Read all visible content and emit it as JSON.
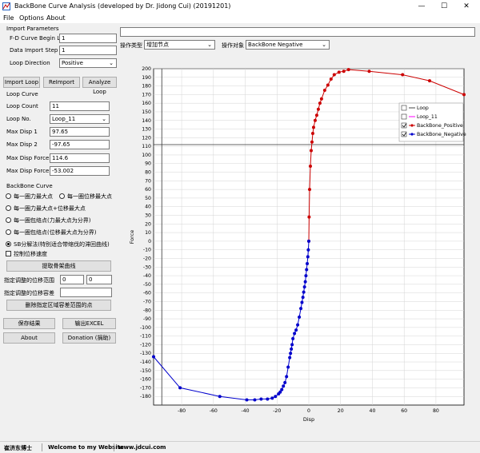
{
  "window": {
    "title": "BackBone Curve Analysis (developed by Dr. Jidong Cui) (20191201)",
    "minimize": "—",
    "maximize": "☐",
    "close": "✕"
  },
  "menu": [
    "File",
    "Options",
    "About"
  ],
  "import": {
    "group_label": "Import Parameters",
    "curve_begin_label": "F-D Curve Begin Line",
    "curve_begin_value": "1",
    "data_step_label": "Data Import Step",
    "data_step_value": "1",
    "loop_dir_label": "Loop Direction",
    "loop_dir_value": "Positive"
  },
  "buttons": {
    "import_loop": "Import Loop",
    "reimport": "ReImport",
    "analyze_loop": "Analyze Loop",
    "extract": "提取骨架曲线",
    "delete_points": "删除指定区域容差范围的点",
    "save": "保存结果",
    "export": "输出EXCEL",
    "about": "About",
    "donation": "Donation (捐助)"
  },
  "loop": {
    "group_label": "Loop Curve",
    "count_label": "Loop Count",
    "count_value": "11",
    "no_label": "Loop No.",
    "no_value": "Loop_11",
    "max_disp1_label": "Max Disp 1",
    "max_disp1_value": "97.65",
    "max_disp2_label": "Max Disp 2",
    "max_disp2_value": "-97.65",
    "max_force1_label": "Max Disp Force 1",
    "max_force1_value": "114.6",
    "max_force2_label": "Max Disp Force 2",
    "max_force2_value": "-53.002"
  },
  "backbone": {
    "group_label": "BackBone Curve",
    "opt1": "每一圈力最大点",
    "opt2": "每一圈位移最大点",
    "opt3": "每一圈力最大点+位移最大点",
    "opt4": "每一圈包络点(力最大点为分界)",
    "opt5": "每一圈包络点(位移最大点为分界)",
    "opt6": "SB分解法(特别适合带缩伐的滞回曲线)",
    "ctrl_label": "控制位移速度",
    "range_label": "指定调整的位移范围",
    "range_from": "0",
    "range_to": "0",
    "tol_label": "指定调整的位移容差",
    "tol_value": ""
  },
  "toolbar": {
    "op_type_label": "操作类型",
    "op_type_value": "增加节点",
    "op_obj_label": "操作对象",
    "op_obj_value": "BackBone Negative"
  },
  "status": {
    "author": "崔济东博士",
    "welcome": "Welcome to my Website",
    "site": "www.jdcui.com"
  },
  "colors": {
    "positive": "#cc0000",
    "negative": "#0000cc",
    "cursor": "#333333"
  },
  "chart_data": {
    "type": "line",
    "xlabel": "Disp",
    "ylabel": "Force",
    "xlim": [
      -97.65,
      97.65
    ],
    "ylim": [
      -190,
      200
    ],
    "xticks": [
      -80,
      -60,
      -40,
      -20,
      0,
      20,
      40,
      60,
      80
    ],
    "yticks": [
      -180,
      -170,
      -160,
      -150,
      -140,
      -130,
      -120,
      -110,
      -100,
      -90,
      -80,
      -70,
      -60,
      -50,
      -40,
      -30,
      -20,
      -10,
      0,
      10,
      20,
      30,
      40,
      50,
      60,
      70,
      80,
      90,
      100,
      110,
      120,
      130,
      140,
      150,
      160,
      170,
      180,
      190,
      200
    ],
    "grid": true,
    "legend_position": "top-right",
    "legend": [
      {
        "label": "Loop",
        "checked": false
      },
      {
        "label": "Loop_11",
        "checked": false
      },
      {
        "label": "BackBone_Positive",
        "checked": true
      },
      {
        "label": "BackBone_Negative",
        "checked": true
      }
    ],
    "cursor": {
      "x": -92.5,
      "y": 112
    },
    "series": [
      {
        "name": "BackBone_Positive",
        "color": "#cc0000",
        "x": [
          0,
          0.2,
          0.5,
          1,
          1.5,
          2,
          2.5,
          3,
          4,
          5,
          6,
          7,
          8,
          10,
          12,
          14,
          16,
          19,
          22,
          25,
          38,
          59,
          76,
          97.65
        ],
        "y": [
          0,
          28,
          60,
          87,
          105,
          115,
          125,
          132,
          140,
          146,
          153,
          160,
          165,
          175,
          181,
          188,
          193,
          196,
          197,
          199,
          197,
          193,
          186,
          170
        ]
      },
      {
        "name": "BackBone_Negative",
        "color": "#0000cc",
        "x": [
          0,
          -0.3,
          -0.6,
          -1,
          -1.4,
          -1.8,
          -2.2,
          -2.7,
          -3.2,
          -3.7,
          -4.3,
          -5,
          -6,
          -7,
          -8,
          -9,
          -10,
          -10.5,
          -11,
          -11.5,
          -12,
          -13,
          -14,
          -15,
          -16,
          -17,
          -18,
          -19,
          -21,
          -23,
          -26,
          -30,
          -34,
          -39,
          -56,
          -81,
          -97.65
        ],
        "y": [
          0,
          -10,
          -18,
          -26,
          -33,
          -40,
          -47,
          -53,
          -59,
          -65,
          -71,
          -78,
          -88,
          -97,
          -103,
          -107,
          -113,
          -120,
          -125,
          -130,
          -135,
          -146,
          -157,
          -164,
          -168,
          -172,
          -175,
          -177,
          -180,
          -182,
          -183,
          -183,
          -184,
          -184,
          -180,
          -170,
          -134
        ]
      }
    ]
  }
}
